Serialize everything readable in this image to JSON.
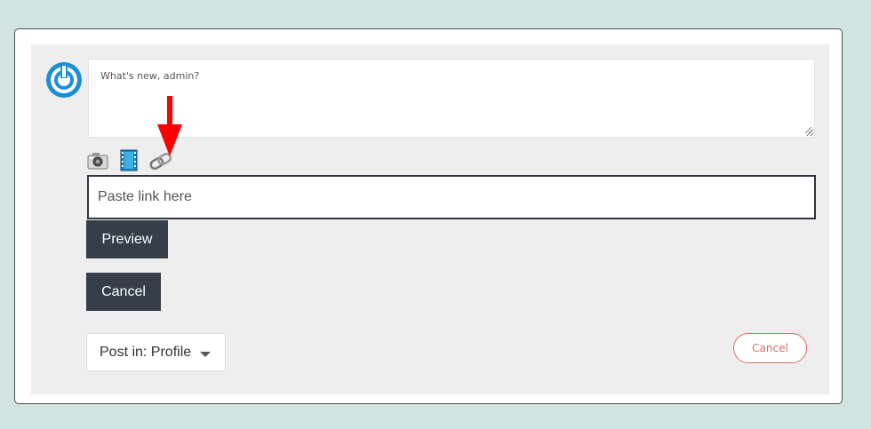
{
  "composer": {
    "placeholder": "What's new, admin?"
  },
  "media_icons": [
    "camera-icon",
    "video-film-icon",
    "link-chain-icon"
  ],
  "link": {
    "placeholder": "Paste link here"
  },
  "buttons": {
    "preview": "Preview",
    "cancel": "Cancel"
  },
  "post_in": {
    "label": "Post in: Profile"
  },
  "cancel_outline": "Cancel",
  "colors": {
    "background": "#d2e4df",
    "dark_button": "#363e48",
    "cancel_accent": "#e06b63",
    "avatar_blue": "#1a8fd6",
    "annotation_arrow": "#ff0000"
  }
}
